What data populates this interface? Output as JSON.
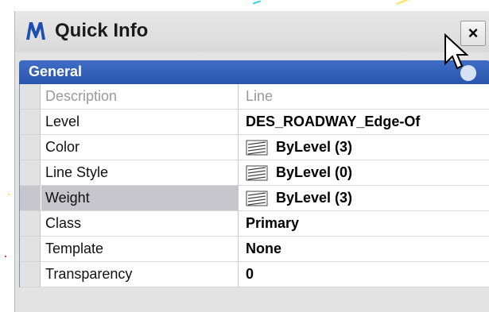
{
  "panel": {
    "title": "Quick Info",
    "close_label": "×",
    "group": {
      "title": "General"
    },
    "properties": [
      {
        "name": "Description",
        "value": "Line",
        "disabled": true
      },
      {
        "name": "Level",
        "value": "DES_ROADWAY_Edge-Of"
      },
      {
        "name": "Color",
        "value": "ByLevel (3)",
        "icon": "level-symbology-icon"
      },
      {
        "name": "Line Style",
        "value": "ByLevel (0)",
        "icon": "level-symbology-icon"
      },
      {
        "name": "Weight",
        "value": "ByLevel (3)",
        "icon": "level-symbology-icon",
        "selected": true,
        "dropdown": true
      },
      {
        "name": "Class",
        "value": "Primary"
      },
      {
        "name": "Template",
        "value": "None"
      },
      {
        "name": "Transparency",
        "value": "0"
      }
    ]
  },
  "colors": {
    "header_blue": "#2f5cb5",
    "selected_row": "#c6c6cc",
    "panel_bg": "#e3e3e3"
  }
}
